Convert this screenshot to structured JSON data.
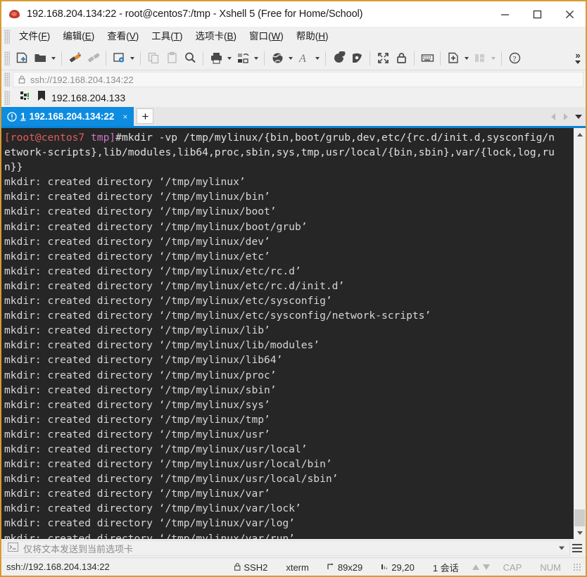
{
  "window": {
    "title": "192.168.204.134:22 - root@centos7:/tmp - Xshell 5 (Free for Home/School)",
    "app_icon": "xshell-icon",
    "minimize_label": "Minimize",
    "maximize_label": "Maximize",
    "close_label": "Close",
    "border_color": "#d79b33"
  },
  "menu": {
    "items": [
      {
        "pre": "文件(",
        "key": "F",
        "post": ")"
      },
      {
        "pre": "编辑(",
        "key": "E",
        "post": ")"
      },
      {
        "pre": "查看(",
        "key": "V",
        "post": ")"
      },
      {
        "pre": "工具(",
        "key": "T",
        "post": ")"
      },
      {
        "pre": "选项卡(",
        "key": "B",
        "post": ")"
      },
      {
        "pre": "窗口(",
        "key": "W",
        "post": ")"
      },
      {
        "pre": "帮助(",
        "key": "H",
        "post": ")"
      }
    ]
  },
  "toolbar": {
    "overflow_label": "»",
    "buttons": [
      "new-session-icon",
      "open-folder-icon",
      "reconnect-icon",
      "disconnect-icon",
      "session-properties-icon",
      "copy-icon",
      "paste-icon",
      "find-icon",
      "print-icon",
      "file-transfer-icon",
      "globe-icon",
      "font-icon",
      "log-start-icon",
      "log-stop-icon",
      "fullscreen-icon",
      "lock-icon",
      "keyboard-icon",
      "add-to-folder-icon",
      "layout-icon",
      "help-icon"
    ]
  },
  "address": {
    "lock_icon": "lock-icon",
    "value": "ssh://192.168.204.134:22"
  },
  "bookmark": {
    "connect_icon": "quick-connect-icon",
    "bookmark_icon": "bookmark-icon",
    "label": "192.168.204.133"
  },
  "tabs": {
    "active": {
      "warn_icon": "alert-circle-icon",
      "number": "1",
      "label": "192.168.204.134:22",
      "close_label": "×"
    },
    "add_label": "+",
    "nav_prev": "prev-tab-icon",
    "nav_next": "next-tab-icon",
    "nav_menu": "tab-list-icon"
  },
  "terminal": {
    "prompt_user": "[root@centos7",
    "prompt_path": " tmp]",
    "prompt_sigil": "#",
    "command": "mkdir -vp /tmp/mylinux/{bin,boot/grub,dev,etc/{rc.d/init.d,sysconfig/n",
    "command_wrap_2": "etwork-scripts},lib/modules,lib64,proc,sbin,sys,tmp,usr/local/{bin,sbin},var/{lock,log,ru",
    "command_wrap_3": "n}}",
    "output_prefix": "mkdir: created directory ",
    "created": [
      "'/tmp/mylinux'",
      "'/tmp/mylinux/bin'",
      "'/tmp/mylinux/boot'",
      "'/tmp/mylinux/boot/grub'",
      "'/tmp/mylinux/dev'",
      "'/tmp/mylinux/etc'",
      "'/tmp/mylinux/etc/rc.d'",
      "'/tmp/mylinux/etc/rc.d/init.d'",
      "'/tmp/mylinux/etc/sysconfig'",
      "'/tmp/mylinux/etc/sysconfig/network-scripts'",
      "'/tmp/mylinux/lib'",
      "'/tmp/mylinux/lib/modules'",
      "'/tmp/mylinux/lib64'",
      "'/tmp/mylinux/proc'",
      "'/tmp/mylinux/sbin'",
      "'/tmp/mylinux/sys'",
      "'/tmp/mylinux/tmp'",
      "'/tmp/mylinux/usr'",
      "'/tmp/mylinux/usr/local'",
      "'/tmp/mylinux/usr/local/bin'",
      "'/tmp/mylinux/usr/local/sbin'",
      "'/tmp/mylinux/var'",
      "'/tmp/mylinux/var/lock'",
      "'/tmp/mylinux/var/log'",
      "'/tmp/mylinux/var/run'"
    ],
    "colors": {
      "background": "#262626",
      "foreground": "#d6d6d6",
      "prompt_user": "#e05c5c",
      "prompt_path": "#c678c6",
      "cursor": "#25e125"
    }
  },
  "sendbar": {
    "icon": "terminal-prompt-icon",
    "placeholder": "仅将文本发送到当前选项卡",
    "menu_icon": "hamburger-icon"
  },
  "statusbar": {
    "connection": "ssh://192.168.204.134:22",
    "lock_icon": "lock-icon",
    "protocol": "SSH2",
    "term_type": "xterm",
    "size_icon": "resize-icon",
    "size": "89x29",
    "cursor_icon": "cursor-pos-icon",
    "cursor_pos": "29,20",
    "sessions": "1 会话",
    "cap": "CAP",
    "num": "NUM"
  }
}
